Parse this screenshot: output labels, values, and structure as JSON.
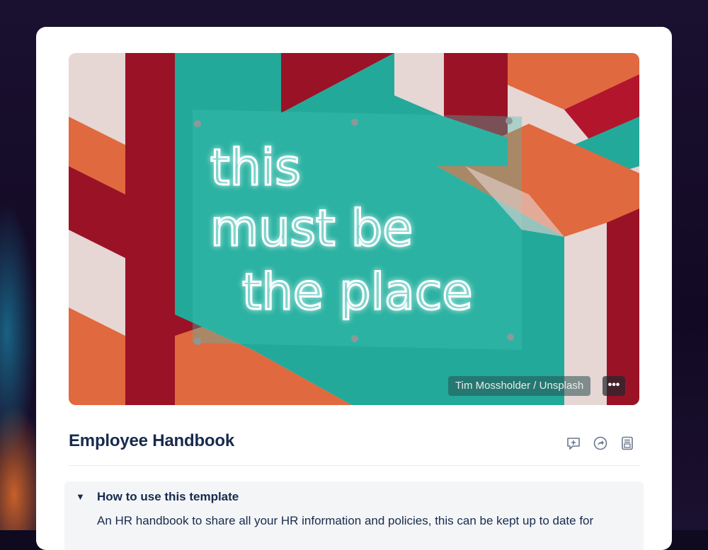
{
  "cover": {
    "credit": "Tim Mossholder / Unsplash",
    "more_label": "•••",
    "neon_lines": [
      "this",
      "must be",
      "the place"
    ]
  },
  "page": {
    "title": "Employee Handbook"
  },
  "actions": {
    "icons": [
      "add-comment-icon",
      "share-icon",
      "page-layout-icon"
    ]
  },
  "expand": {
    "caret": "▼",
    "title": "How to use this template",
    "body": "An HR handbook to share all your HR information and policies, this can be kept up to date for"
  },
  "colors": {
    "teal": "#23a99a",
    "red": "#9a1226",
    "orange": "#e0693f",
    "pink": "#e8dcdc",
    "text": "#172b4d"
  }
}
